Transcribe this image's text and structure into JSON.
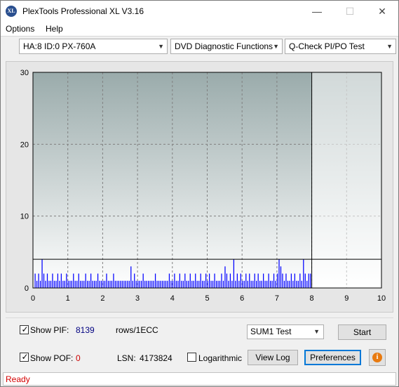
{
  "window": {
    "title": "PlexTools Professional XL V3.16",
    "icon_label": "XL",
    "min_glyph": "—",
    "max_glyph": "☐",
    "close_glyph": "✕"
  },
  "menu": {
    "options": "Options",
    "help": "Help"
  },
  "toolbar": {
    "drive": "HA:8 ID:0  PX-760A",
    "function": "DVD Diagnostic Functions",
    "test": "Q-Check PI/PO Test"
  },
  "chart_data": {
    "type": "bar",
    "title": "",
    "xlabel": "",
    "ylabel": "",
    "xlim": [
      0,
      10
    ],
    "ylim": [
      0,
      30
    ],
    "x_ticks": [
      "0",
      "1",
      "2",
      "3",
      "4",
      "5",
      "6",
      "7",
      "8",
      "9",
      "10"
    ],
    "y_ticks": [
      "0",
      "10",
      "20",
      "30"
    ],
    "grid": "dashed",
    "threshold_line": 4,
    "scan_end_position": 8,
    "series": [
      {
        "color": "#0000ff",
        "x": [
          0.05,
          0.1,
          0.15,
          0.2,
          0.25,
          0.3,
          0.35,
          0.4,
          0.45,
          0.5,
          0.55,
          0.6,
          0.65,
          0.7,
          0.75,
          0.8,
          0.85,
          0.9,
          0.95,
          1.0,
          1.05,
          1.1,
          1.15,
          1.2,
          1.25,
          1.3,
          1.35,
          1.4,
          1.45,
          1.5,
          1.55,
          1.6,
          1.65,
          1.7,
          1.75,
          1.8,
          1.85,
          1.9,
          1.95,
          2.0,
          2.05,
          2.1,
          2.15,
          2.2,
          2.25,
          2.3,
          2.35,
          2.4,
          2.45,
          2.5,
          2.55,
          2.6,
          2.65,
          2.7,
          2.75,
          2.8,
          2.85,
          2.9,
          2.95,
          3.0,
          3.05,
          3.1,
          3.15,
          3.2,
          3.25,
          3.3,
          3.35,
          3.4,
          3.45,
          3.5,
          3.55,
          3.6,
          3.65,
          3.7,
          3.75,
          3.8,
          3.85,
          3.9,
          3.95,
          4.0,
          4.05,
          4.1,
          4.15,
          4.2,
          4.25,
          4.3,
          4.35,
          4.4,
          4.45,
          4.5,
          4.55,
          4.6,
          4.65,
          4.7,
          4.75,
          4.8,
          4.85,
          4.9,
          4.95,
          5.0,
          5.05,
          5.1,
          5.15,
          5.2,
          5.25,
          5.3,
          5.35,
          5.4,
          5.45,
          5.5,
          5.55,
          5.6,
          5.65,
          5.7,
          5.75,
          5.8,
          5.85,
          5.9,
          5.95,
          6.0,
          6.05,
          6.1,
          6.15,
          6.2,
          6.25,
          6.3,
          6.35,
          6.4,
          6.45,
          6.5,
          6.55,
          6.6,
          6.65,
          6.7,
          6.75,
          6.8,
          6.85,
          6.9,
          6.95,
          7.0,
          7.05,
          7.1,
          7.15,
          7.2,
          7.25,
          7.3,
          7.35,
          7.4,
          7.45,
          7.5,
          7.55,
          7.6,
          7.65,
          7.7,
          7.75,
          7.8,
          7.85,
          7.9,
          7.95
        ],
        "values": [
          2,
          1,
          2,
          1,
          4,
          2,
          1,
          2,
          1,
          1,
          2,
          1,
          1,
          2,
          1,
          2,
          1,
          1,
          2,
          1,
          1,
          1,
          2,
          1,
          1,
          2,
          1,
          1,
          1,
          2,
          1,
          1,
          2,
          1,
          1,
          1,
          2,
          1,
          1,
          1,
          1,
          2,
          1,
          1,
          1,
          2,
          1,
          1,
          1,
          1,
          1,
          1,
          1,
          1,
          1,
          3,
          1,
          2,
          1,
          1,
          1,
          1,
          2,
          1,
          1,
          1,
          1,
          1,
          1,
          2,
          1,
          1,
          1,
          1,
          1,
          1,
          1,
          2,
          1,
          1,
          2,
          1,
          1,
          2,
          1,
          1,
          2,
          1,
          1,
          2,
          1,
          1,
          2,
          1,
          1,
          2,
          1,
          1,
          2,
          1,
          2,
          1,
          1,
          2,
          1,
          1,
          1,
          2,
          1,
          3,
          2,
          1,
          2,
          1,
          4,
          1,
          2,
          1,
          2,
          1,
          1,
          2,
          1,
          2,
          1,
          1,
          2,
          1,
          2,
          1,
          1,
          2,
          1,
          1,
          2,
          1,
          1,
          2,
          1,
          2,
          4,
          3,
          2,
          1,
          2,
          1,
          1,
          2,
          1,
          2,
          1,
          1,
          2,
          1,
          4,
          2,
          1,
          2,
          2
        ]
      }
    ]
  },
  "controls": {
    "show_pif_label": "Show PIF:",
    "pif_value": "8139",
    "pif_unit": "rows/1ECC",
    "show_pof_label": "Show POF:",
    "pof_value": "0",
    "lsn_label": "LSN:",
    "lsn_value": "4173824",
    "logarithmic_label": "Logarithmic",
    "sum_select": "SUM1 Test",
    "start_button": "Start",
    "view_log_button": "View Log",
    "preferences_button": "Preferences",
    "info_glyph": "i",
    "check_glyph": "✓",
    "show_pif_checked": true,
    "show_pof_checked": true,
    "logarithmic_checked": false
  },
  "status": {
    "text": "Ready"
  },
  "colors": {
    "pif_value": "#000080",
    "pof_value": "#cc0000",
    "status_text": "#d40000",
    "bars": "#0000ff",
    "plot_top": "#9aabab",
    "plot_bottom": "#ffffff"
  }
}
